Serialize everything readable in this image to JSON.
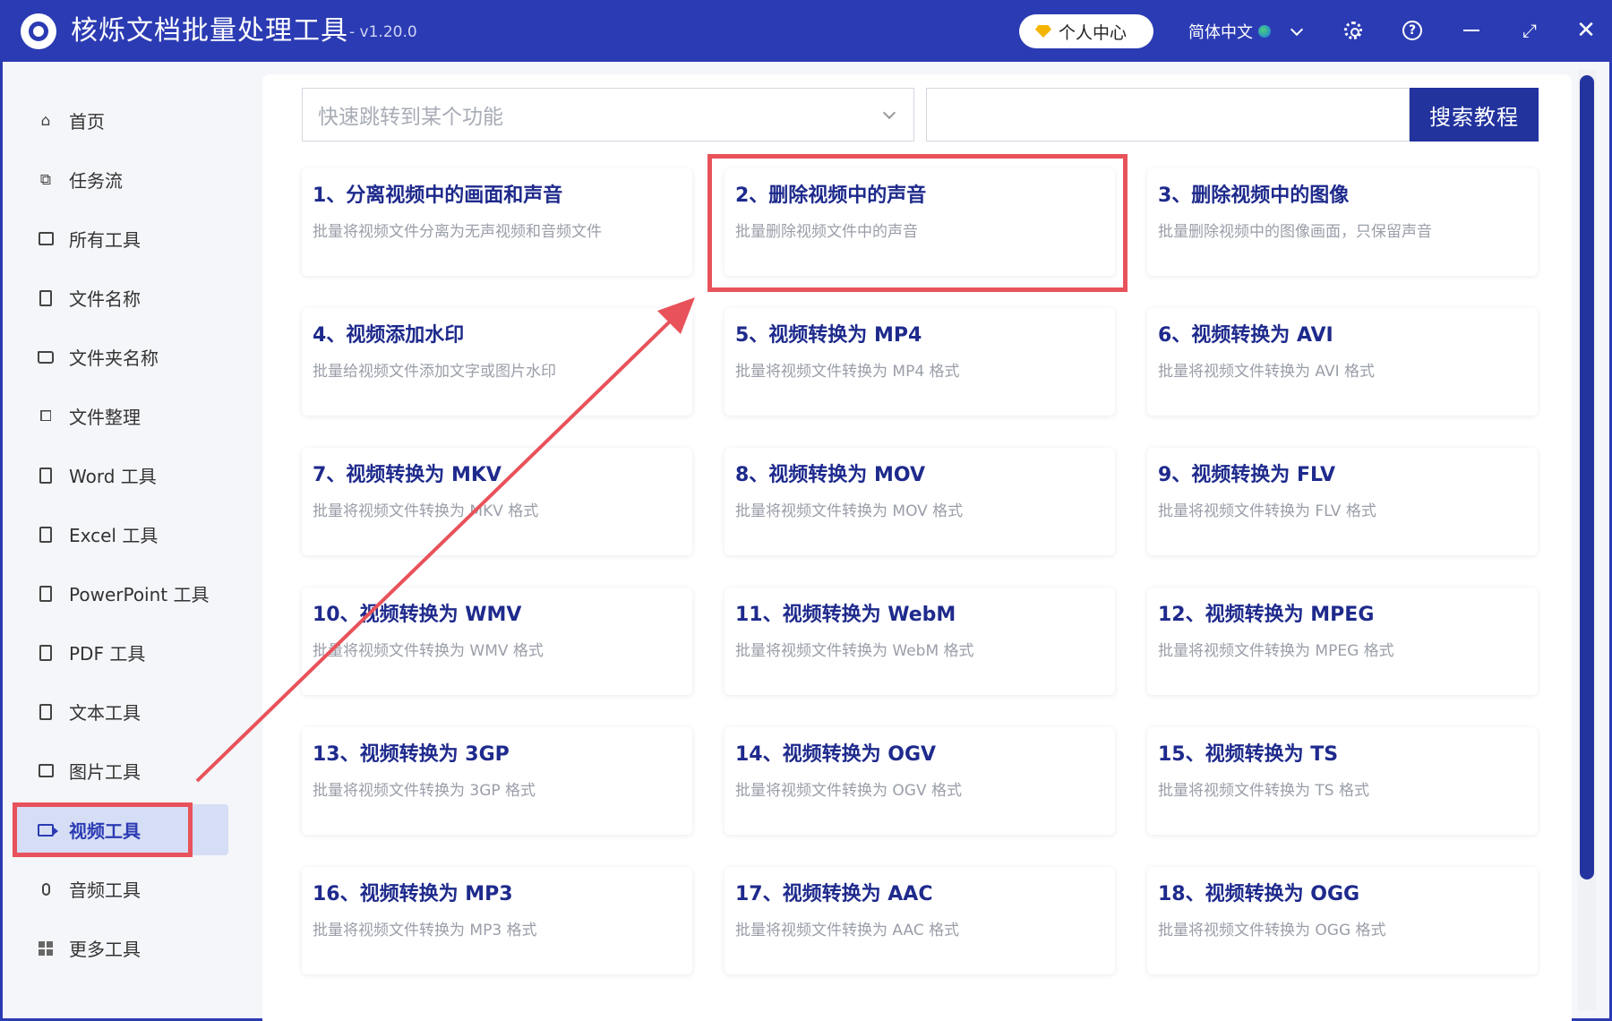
{
  "app": {
    "title": "核烁文档批量处理工具",
    "version": "- v1.20.0",
    "personal_center": "个人中心",
    "language": "简体中文"
  },
  "sidebar": {
    "items": [
      {
        "label": "首页",
        "icon": "home-icon"
      },
      {
        "label": "任务流",
        "icon": "workflow-icon"
      },
      {
        "label": "所有工具",
        "icon": "monitor-icon"
      },
      {
        "label": "文件名称",
        "icon": "file-icon"
      },
      {
        "label": "文件夹名称",
        "icon": "folder-icon"
      },
      {
        "label": "文件整理",
        "icon": "organize-icon"
      },
      {
        "label": "Word 工具",
        "icon": "word-icon"
      },
      {
        "label": "Excel 工具",
        "icon": "excel-icon"
      },
      {
        "label": "PowerPoint 工具",
        "icon": "powerpoint-icon"
      },
      {
        "label": "PDF 工具",
        "icon": "pdf-icon"
      },
      {
        "label": "文本工具",
        "icon": "text-icon"
      },
      {
        "label": "图片工具",
        "icon": "image-icon"
      },
      {
        "label": "视频工具",
        "icon": "video-icon",
        "active": true
      },
      {
        "label": "音频工具",
        "icon": "mic-icon"
      },
      {
        "label": "更多工具",
        "icon": "grid-icon"
      }
    ]
  },
  "toolbar": {
    "jump_placeholder": "快速跳转到某个功能",
    "search_value": "",
    "search_button": "搜索教程"
  },
  "cards": [
    {
      "title": "1、分离视频中的画面和声音",
      "desc": "批量将视频文件分离为无声视频和音频文件"
    },
    {
      "title": "2、删除视频中的声音",
      "desc": "批量删除视频文件中的声音"
    },
    {
      "title": "3、删除视频中的图像",
      "desc": "批量删除视频中的图像画面，只保留声音"
    },
    {
      "title": "4、视频添加水印",
      "desc": "批量给视频文件添加文字或图片水印"
    },
    {
      "title": "5、视频转换为 MP4",
      "desc": "批量将视频文件转换为 MP4 格式"
    },
    {
      "title": "6、视频转换为 AVI",
      "desc": "批量将视频文件转换为 AVI 格式"
    },
    {
      "title": "7、视频转换为 MKV",
      "desc": "批量将视频文件转换为 MKV 格式"
    },
    {
      "title": "8、视频转换为 MOV",
      "desc": "批量将视频文件转换为 MOV 格式"
    },
    {
      "title": "9、视频转换为 FLV",
      "desc": "批量将视频文件转换为 FLV 格式"
    },
    {
      "title": "10、视频转换为 WMV",
      "desc": "批量将视频文件转换为 WMV 格式"
    },
    {
      "title": "11、视频转换为 WebM",
      "desc": "批量将视频文件转换为 WebM 格式"
    },
    {
      "title": "12、视频转换为 MPEG",
      "desc": "批量将视频文件转换为 MPEG 格式"
    },
    {
      "title": "13、视频转换为 3GP",
      "desc": "批量将视频文件转换为 3GP 格式"
    },
    {
      "title": "14、视频转换为 OGV",
      "desc": "批量将视频文件转换为 OGV 格式"
    },
    {
      "title": "15、视频转换为 TS",
      "desc": "批量将视频文件转换为 TS 格式"
    },
    {
      "title": "16、视频转换为 MP3",
      "desc": "批量将视频文件转换为 MP3 格式"
    },
    {
      "title": "17、视频转换为 AAC",
      "desc": "批量将视频文件转换为 AAC 格式"
    },
    {
      "title": "18、视频转换为 OGG",
      "desc": "批量将视频文件转换为 OGG 格式"
    }
  ],
  "colors": {
    "brand": "#2b3bb3",
    "card_title": "#1e2a8c",
    "highlight": "#e8525a",
    "active_bg": "#d6def5"
  }
}
